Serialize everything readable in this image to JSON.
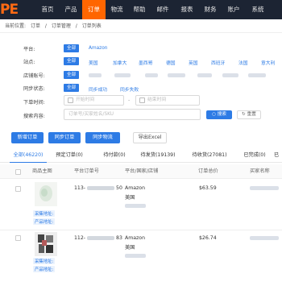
{
  "nav": {
    "logo": "PE",
    "items": [
      "首页",
      "产品",
      "订单",
      "物流",
      "帮助",
      "邮件",
      "报表",
      "财务",
      "账户",
      "系统"
    ],
    "active_index": 2
  },
  "breadcrumb": {
    "label": "当前位置:",
    "items": [
      "订单",
      "/",
      "订单管理",
      "/",
      "订单列表"
    ]
  },
  "filters": {
    "platform": {
      "label": "平台:",
      "all": "全部",
      "options": [
        "Amazon"
      ]
    },
    "site": {
      "label": "站点:",
      "all": "全部",
      "options": [
        "美国",
        "加拿大",
        "墨西哥",
        "德国",
        "英国",
        "西班牙",
        "法国",
        "意大利"
      ]
    },
    "shop": {
      "label": "店铺账号:",
      "all": "全部"
    },
    "sync": {
      "label": "同步状态:",
      "all": "全部",
      "options": [
        "同步成功",
        "同步失败"
      ]
    },
    "order_time": {
      "label": "下单时间:",
      "start_placeholder": "开始时间",
      "separator": "-",
      "end_placeholder": "结束时间"
    },
    "search": {
      "label": "搜索内容:",
      "placeholder": "订单号/买家姓名/SKU",
      "search_button": "搜索",
      "reset_button": "重置"
    }
  },
  "actions": {
    "new_order": "新增订单",
    "sync_order": "同步订单",
    "sync_logistics": "同步物流",
    "export_excel": "导出Excel"
  },
  "tabs": [
    "全部(46220)",
    "预定订单(0)",
    "待付款(0)",
    "待发货(19139)",
    "待收货(27081)",
    "已完成(0)",
    "已"
  ],
  "table": {
    "columns": [
      "商品主图",
      "平台订单号",
      "平台/国家/店铺",
      "订单总价",
      "买家名称"
    ],
    "link_labels": [
      "采集地址:",
      "产品地址:"
    ],
    "rows": [
      {
        "order_prefix": "113-",
        "order_suffix": "50",
        "platform": "Amazon",
        "country": "美国",
        "total": "$63.59"
      },
      {
        "order_prefix": "112-",
        "order_suffix": "83",
        "platform": "Amazon",
        "country": "美国",
        "total": "$26.74"
      }
    ]
  },
  "colors": {
    "nav_bg": "#1c2433",
    "nav_active": "#ff6600",
    "primary": "#2d7be5",
    "logo": "#ff6a13"
  }
}
